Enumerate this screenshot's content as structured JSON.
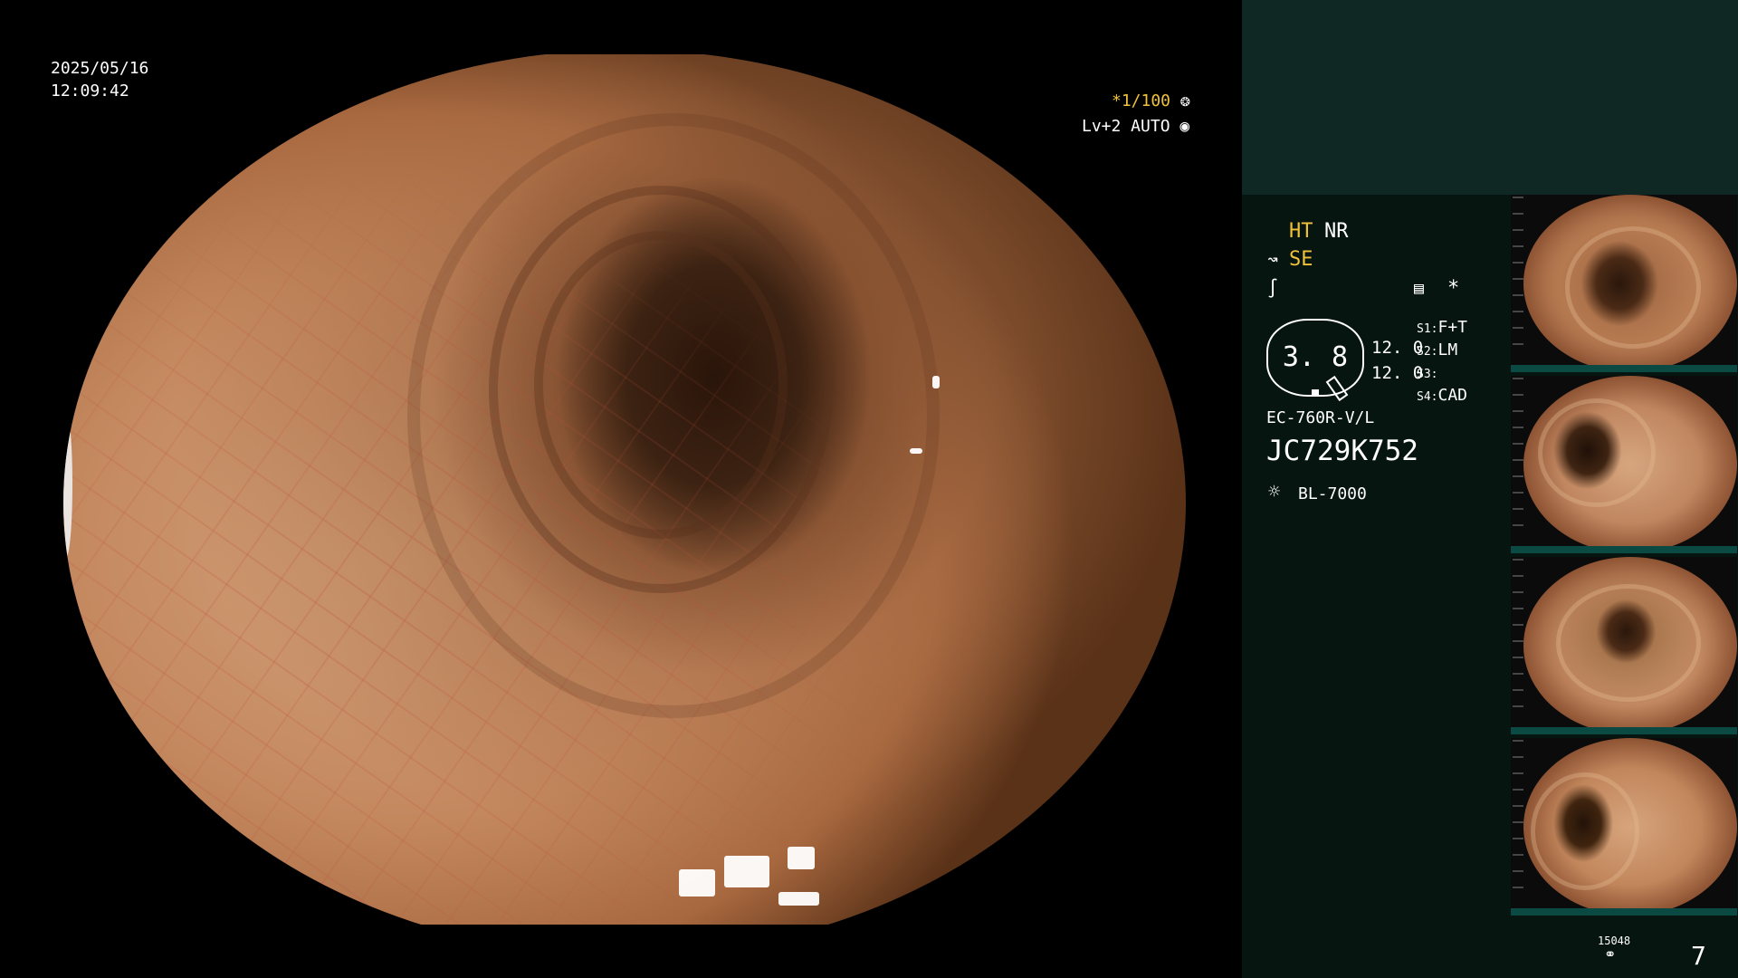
{
  "overlay": {
    "date": "2025/05/16",
    "time": "12:09:42",
    "shutter_value": "*1/100",
    "shutter_icon": "aperture-icon",
    "level_value": "Lv+2 AUTO",
    "level_icon": "iris-icon"
  },
  "panel": {
    "ht_label": "HT",
    "nr_label": "NR",
    "se_label": "SE",
    "se_icon": "scope-tip-icon",
    "freeze_icon": "freeze-icon",
    "record_icon": "memory-icon",
    "star": "*",
    "gauge_value": "3. 8",
    "value_1": "12. 0",
    "value_2": "12. 0",
    "switches": [
      {
        "key": "S1:",
        "value": "F+T"
      },
      {
        "key": "S2:",
        "value": "LM"
      },
      {
        "key": "S3:",
        "value": ""
      },
      {
        "key": "S4:",
        "value": "CAD"
      }
    ],
    "scope_model": "EC-760R-V/L",
    "serial": "JC729K752",
    "light_source_icon": "lamp-icon",
    "light_source": "BL-7000",
    "storage_count": "15048",
    "storage_icon": "storage-icon",
    "image_count": "7"
  },
  "thumbnails": [
    {
      "label": "captured-image-1"
    },
    {
      "label": "captured-image-2"
    },
    {
      "label": "captured-image-3"
    },
    {
      "label": "captured-image-4"
    }
  ],
  "colors": {
    "accent_yellow": "#f0c23a",
    "panel_top": "#102824",
    "panel_bg": "#071511"
  }
}
